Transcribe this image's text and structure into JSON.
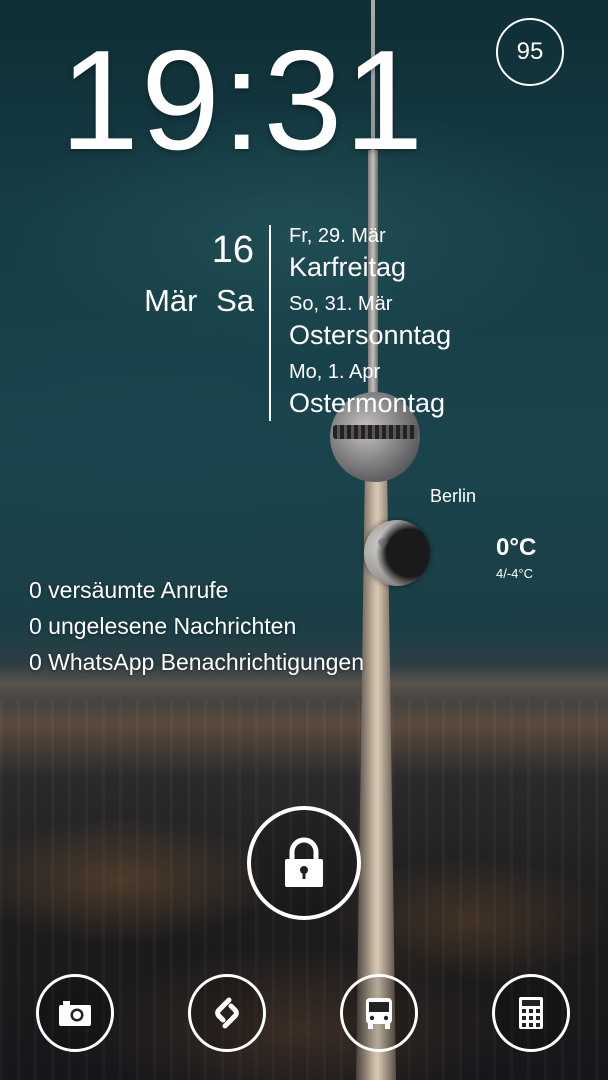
{
  "clock": {
    "time": "19:31"
  },
  "battery": {
    "level": "95"
  },
  "date": {
    "day": "16",
    "month_weekday": "Mär Sa"
  },
  "events": [
    {
      "date": "Fr, 29. Mär",
      "name": "Karfreitag"
    },
    {
      "date": "So, 31. Mär",
      "name": "Ostersonntag"
    },
    {
      "date": "Mo, 1. Apr",
      "name": "Ostermontag"
    }
  ],
  "weather": {
    "city": "Berlin",
    "temp": "0°C",
    "range": "4/-4°C",
    "icon": "moon-phase-icon"
  },
  "notifications": [
    "0 versäumte Anrufe",
    "0 ungelesene Nachrichten",
    "0 WhatsApp Benachrichtigungen"
  ],
  "lock": {
    "icon": "padlock-icon"
  },
  "dock": [
    {
      "icon": "camera-icon"
    },
    {
      "icon": "shazam-icon"
    },
    {
      "icon": "bus-icon"
    },
    {
      "icon": "calculator-icon"
    }
  ]
}
